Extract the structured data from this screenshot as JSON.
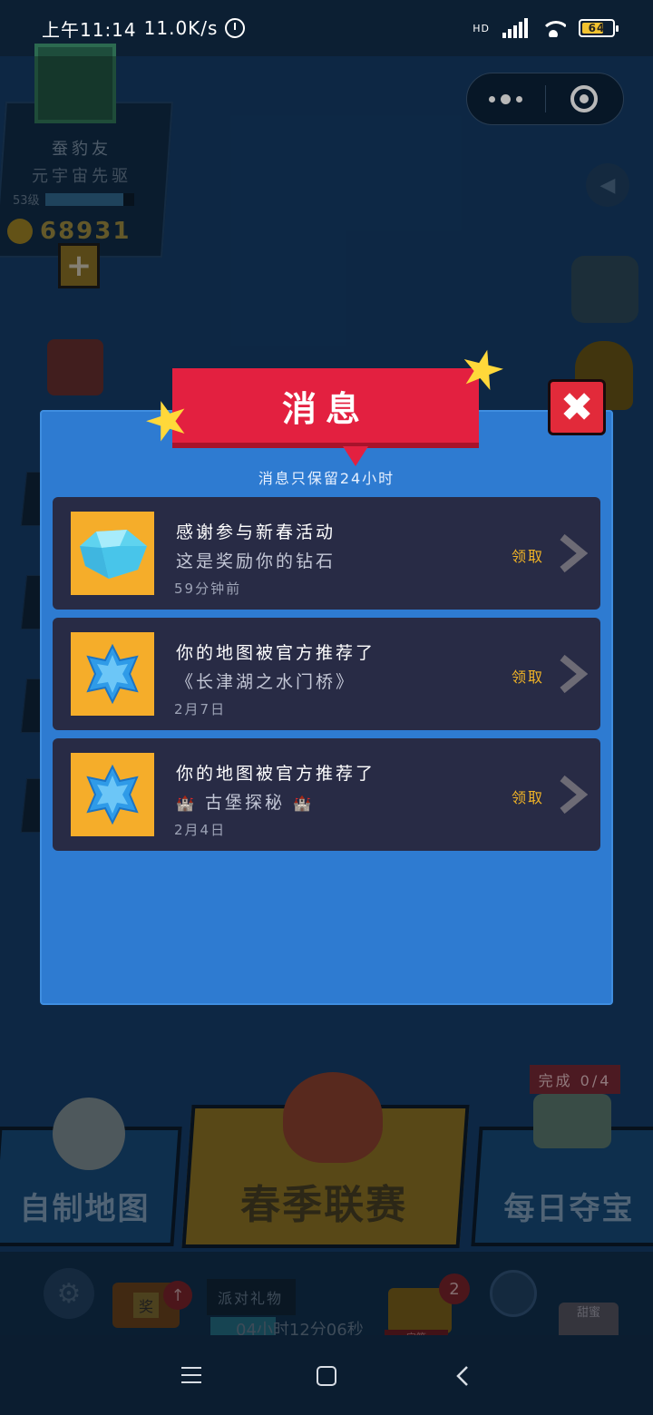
{
  "status_bar": {
    "time": "上午11:14",
    "net_speed": "11.0K/s",
    "network": "HD",
    "battery": "64"
  },
  "profile": {
    "name": "蚕豹友",
    "title": "元宇宙先驱",
    "level": "53级",
    "coins": "68931"
  },
  "modal": {
    "title": "消息",
    "notice": "消息只保留24小时",
    "close": "✖",
    "messages": [
      {
        "title": "感谢参与新春活动",
        "subtitle": "这是奖励你的钻石",
        "time": "59分钟前",
        "action": "领取",
        "icon": "diamond-icon"
      },
      {
        "title": "你的地图被官方推荐了",
        "subtitle": "《长津湖之水门桥》",
        "time": "2月7日",
        "action": "领取",
        "icon": "blue-star-icon"
      },
      {
        "title": "你的地图被官方推荐了",
        "subtitle": "古堡探秘",
        "time": "2月4日",
        "action": "领取",
        "icon": "blue-star-icon"
      }
    ]
  },
  "bottom_menu": {
    "custom_map": "自制地图",
    "spring_league": "春季联赛",
    "daily_treasure": "每日夺宝",
    "task_progress": "完成 0/4",
    "tv_label": "奖",
    "gift_label": "派对礼物",
    "gift_timer": "04小时12分06秒",
    "chest_count": "2",
    "chest_label": "宝箱",
    "sweet_label": "甜蜜"
  },
  "colors": {
    "modal_bg": "#2e7bd1",
    "banner": "#e32040",
    "card_bg": "#282b45",
    "claim": "#f1b426",
    "thumb": "#f5ad2a"
  }
}
